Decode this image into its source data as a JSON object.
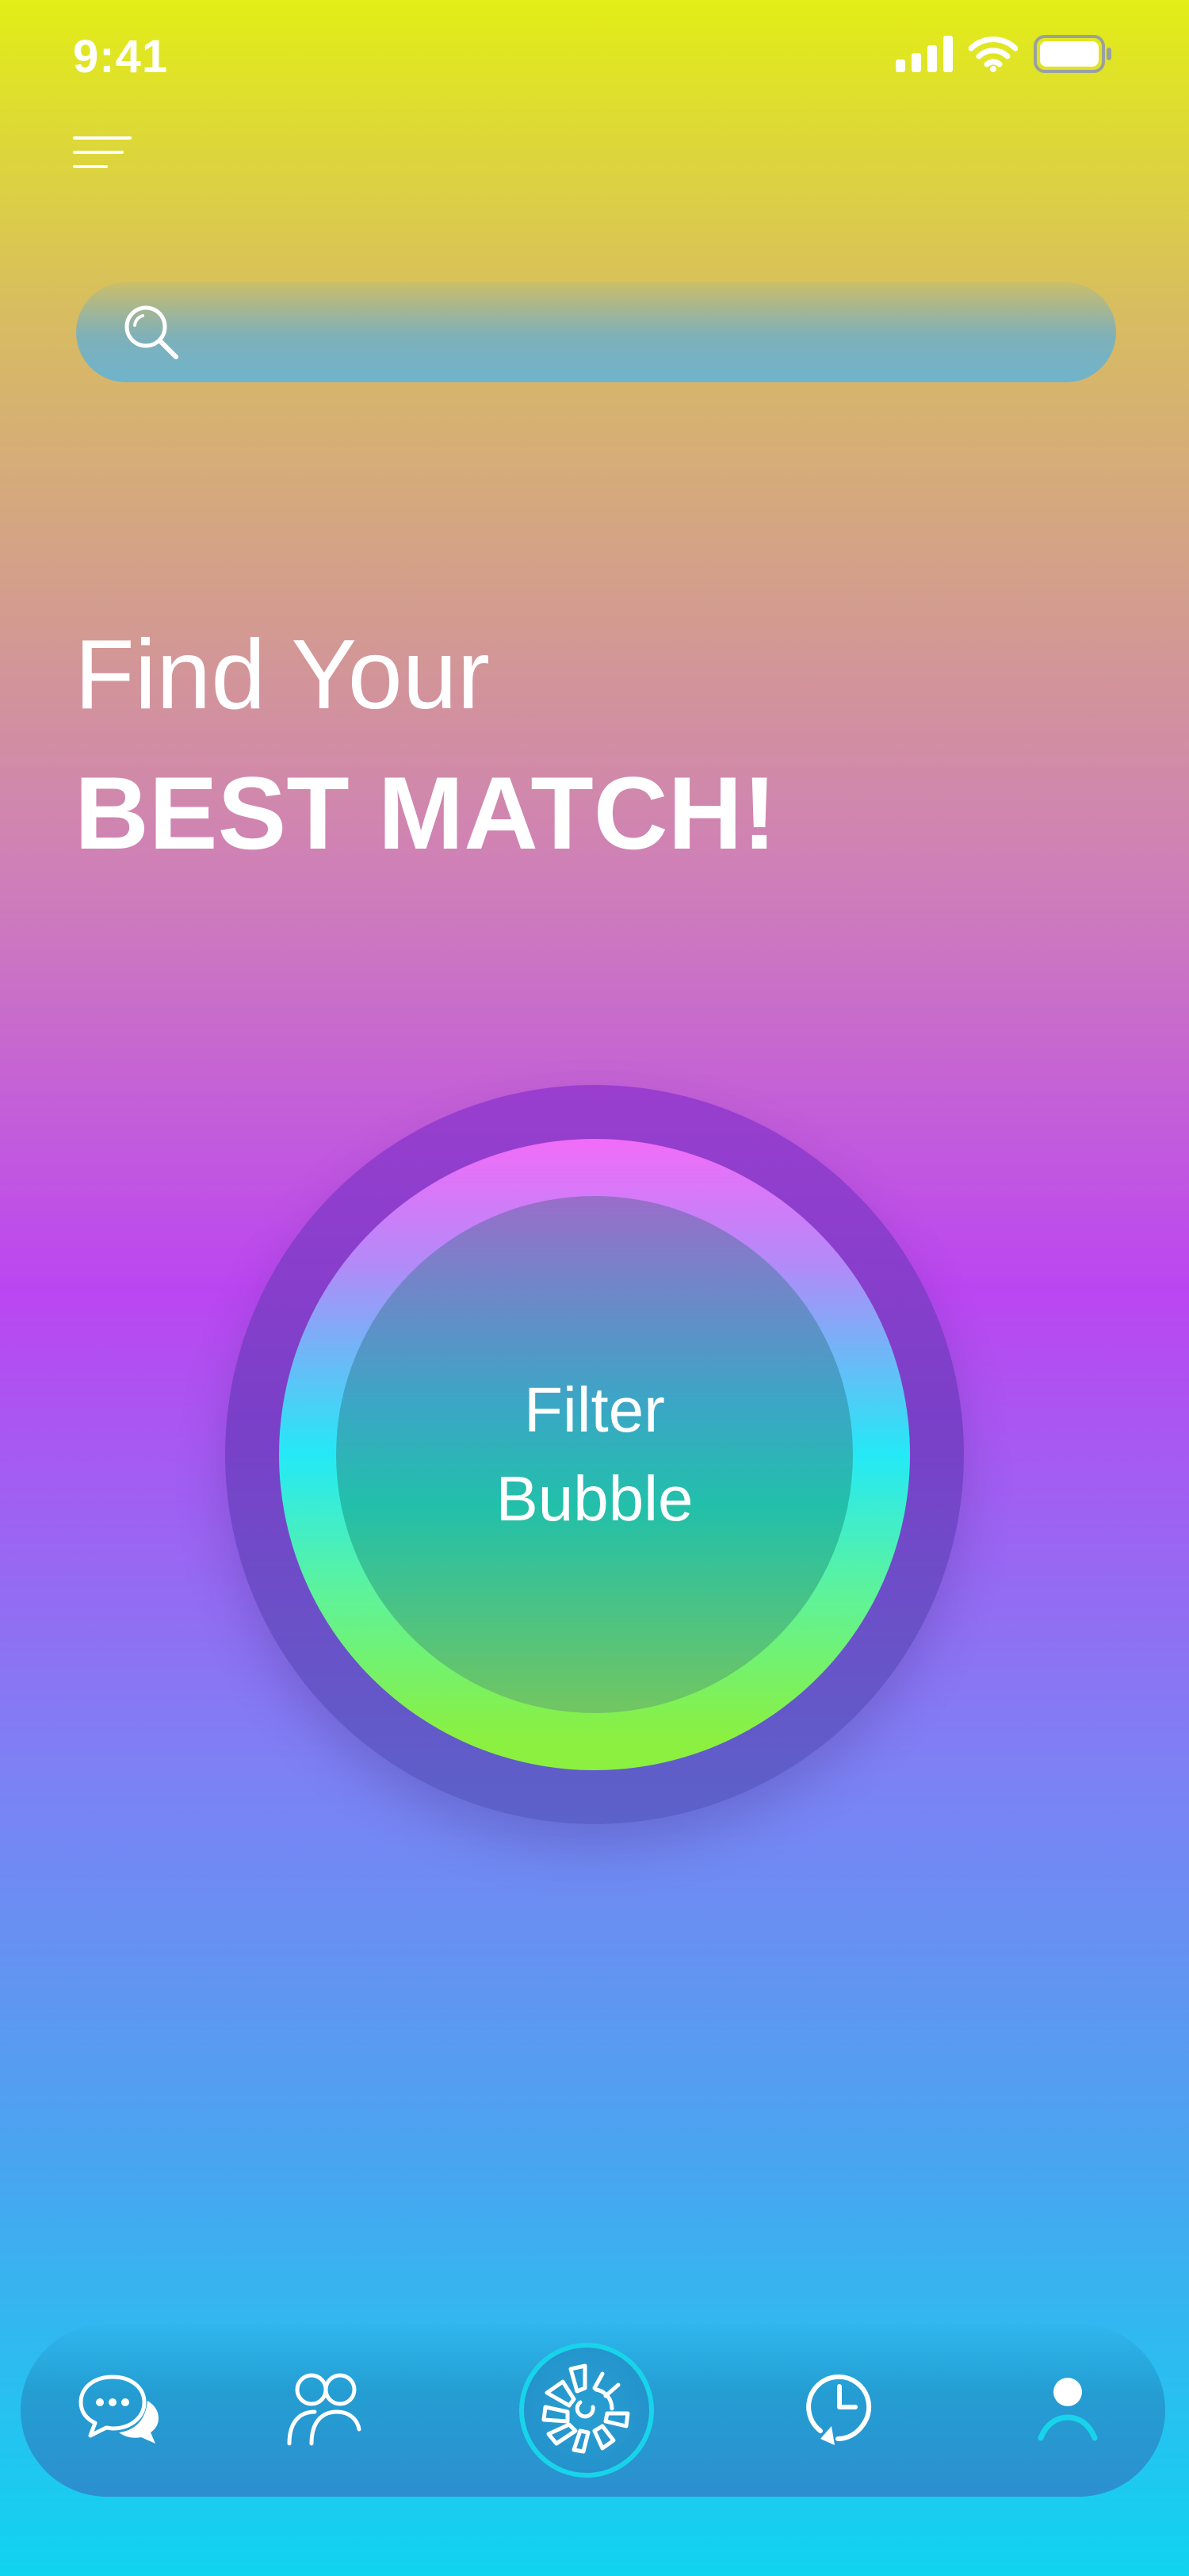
{
  "status_bar": {
    "time": "9:41",
    "icons": [
      "cellular-signal-icon",
      "wifi-icon",
      "battery-icon"
    ]
  },
  "menu": {
    "icon": "hamburger-menu-icon"
  },
  "search": {
    "icon": "search-icon",
    "value": "",
    "placeholder": ""
  },
  "headline": {
    "line1": "Find Your",
    "line2": "BEST MATCH!"
  },
  "bubble": {
    "line1": "Filter",
    "line2": "Bubble"
  },
  "bottom_nav": {
    "items": [
      {
        "icon": "chat-bubbles-icon"
      },
      {
        "icon": "people-icon"
      },
      {
        "icon": "filter-wheel-icon",
        "active": true
      },
      {
        "icon": "history-clock-icon"
      },
      {
        "icon": "profile-icon"
      }
    ]
  },
  "colors": {
    "gradient_top": "#e2ee16",
    "gradient_mid": "#bb46f1",
    "gradient_bottom": "#10d4f0",
    "nav_accent": "#18d4ea",
    "text": "#ffffff"
  }
}
